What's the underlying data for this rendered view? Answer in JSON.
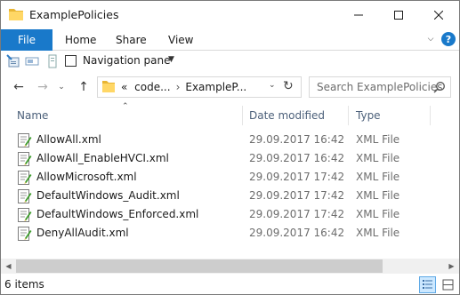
{
  "window": {
    "title": "ExamplePolicies"
  },
  "ribbon": {
    "tabs": [
      {
        "label": "File"
      },
      {
        "label": "Home"
      },
      {
        "label": "Share"
      },
      {
        "label": "View"
      }
    ],
    "help_label": "?"
  },
  "quick_access": {
    "navigation_pane_label": "Navigation pane"
  },
  "address_bar": {
    "prefix": "«",
    "path": [
      "code...",
      "ExampleP..."
    ]
  },
  "search": {
    "placeholder": "Search ExamplePolicies"
  },
  "columns": {
    "name": "Name",
    "date_modified": "Date modified",
    "type": "Type"
  },
  "files": [
    {
      "name": "AllowAll.xml",
      "date": "29.09.2017 16:42",
      "type": "XML File"
    },
    {
      "name": "AllowAll_EnableHVCI.xml",
      "date": "29.09.2017 16:42",
      "type": "XML File"
    },
    {
      "name": "AllowMicrosoft.xml",
      "date": "29.09.2017 17:42",
      "type": "XML File"
    },
    {
      "name": "DefaultWindows_Audit.xml",
      "date": "29.09.2017 17:42",
      "type": "XML File"
    },
    {
      "name": "DefaultWindows_Enforced.xml",
      "date": "29.09.2017 17:42",
      "type": "XML File"
    },
    {
      "name": "DenyAllAudit.xml",
      "date": "29.09.2017 16:42",
      "type": "XML File"
    }
  ],
  "status": {
    "item_count": "6 items"
  },
  "colors": {
    "accent": "#1979ca",
    "header_text": "#4c607a",
    "secondary_text": "#6d6d6d"
  },
  "icons": {
    "folder": "folder-icon",
    "file": "xml-document-icon",
    "search": "search-icon",
    "refresh": "refresh-icon"
  }
}
